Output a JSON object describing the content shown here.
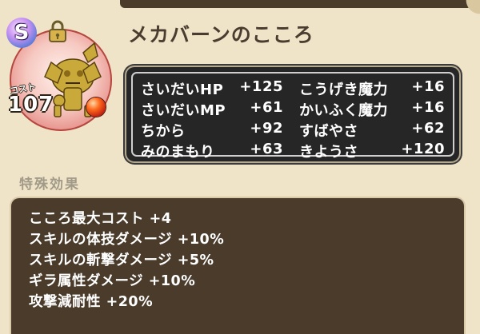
{
  "monster": {
    "name": "メカバーンのこころ",
    "rank": "S",
    "cost_label": "コスト",
    "cost_value": "107",
    "icon": "lock-icon"
  },
  "stats": [
    {
      "label": "さいだいHP",
      "value": "+125"
    },
    {
      "label": "こうげき魔力",
      "value": "+16"
    },
    {
      "label": "さいだいMP",
      "value": "+61"
    },
    {
      "label": "かいふく魔力",
      "value": "+16"
    },
    {
      "label": "ちから",
      "value": "+92"
    },
    {
      "label": "すばやさ",
      "value": "+62"
    },
    {
      "label": "みのまもり",
      "value": "+63"
    },
    {
      "label": "きようさ",
      "value": "+120"
    }
  ],
  "special": {
    "heading": "特殊効果",
    "effects": [
      "こころ最大コスト +4",
      "スキルの体技ダメージ +10%",
      "スキルの斬撃ダメージ +5%",
      "ギラ属性ダメージ +10%",
      "攻撃減耐性 +20%"
    ]
  },
  "colors": {
    "background": "#efe4c8",
    "panel_dark": "#262626",
    "effects_panel": "#4a3b2b",
    "heading_muted": "#a29a88"
  }
}
